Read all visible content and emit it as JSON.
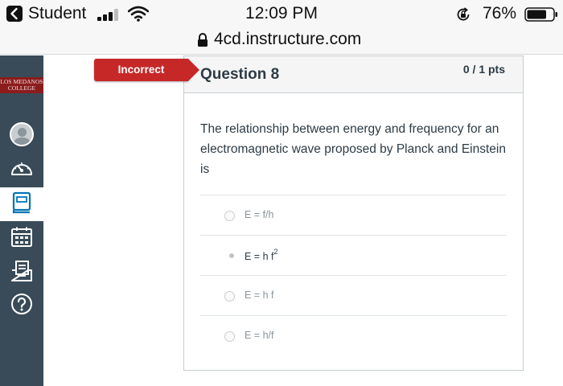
{
  "status_bar": {
    "carrier": "Student",
    "time": "12:09 PM",
    "battery": "76%",
    "icons": [
      "back-icon",
      "signal-icon",
      "wifi-icon",
      "rotation-lock-icon",
      "battery-icon"
    ]
  },
  "browser": {
    "url": "4cd.instructure.com",
    "lock_icon": "lock-icon"
  },
  "sidebar": {
    "logo_text": "LOS MEDANOS COLLEGE",
    "logo_line1": "LOS MEDANOS",
    "logo_line2": "COLLEGE",
    "items": [
      {
        "name": "account",
        "icon": "avatar"
      },
      {
        "name": "dashboard",
        "icon": "dashboard-gauge-icon"
      },
      {
        "name": "courses",
        "icon": "courses-book-icon",
        "active": true
      },
      {
        "name": "calendar",
        "icon": "calendar-icon"
      },
      {
        "name": "inbox",
        "icon": "inbox-icon"
      },
      {
        "name": "help",
        "icon": "help-icon"
      }
    ]
  },
  "quiz": {
    "result_tag": "Incorrect",
    "question_title": "Question 8",
    "points": "0 / 1 pts",
    "question_text": "The relationship between energy and frequency for an electromagnetic wave proposed by Planck and Einstein is",
    "answers": [
      {
        "label": "E = f/h",
        "selected": false
      },
      {
        "label": "E = h f",
        "superscript": "2",
        "selected": true
      },
      {
        "label": "E = h f",
        "selected": false
      },
      {
        "label": "E = h/f",
        "selected": false
      }
    ]
  },
  "colors": {
    "sidebar": "#394b58",
    "incorrect_red": "#c62828",
    "logo_red": "#8b1c1c",
    "text": "#2d3b45"
  }
}
